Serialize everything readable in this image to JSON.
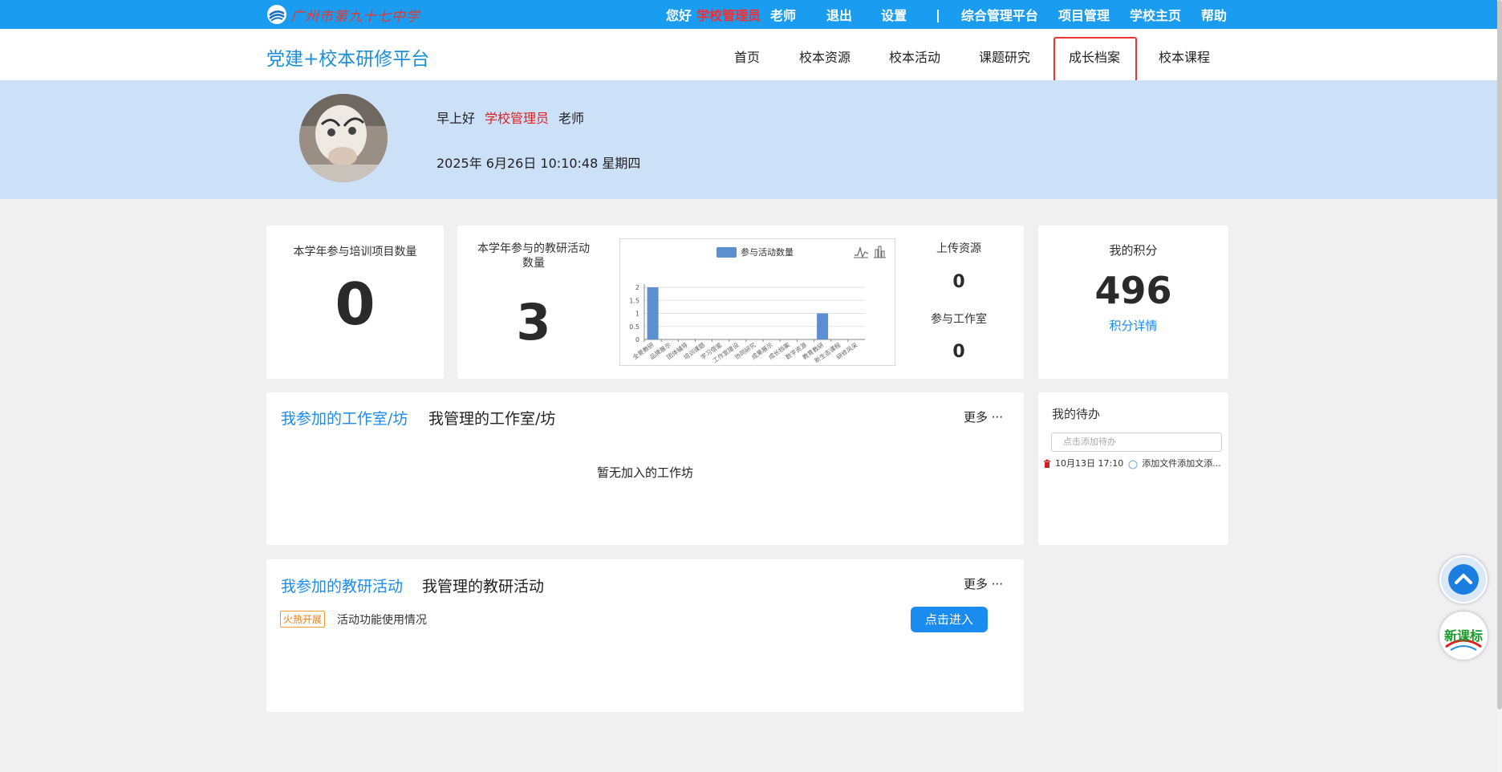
{
  "topbar": {
    "logo_text": "广州市第九十七中学",
    "greeting": "您好",
    "role": "学校管理员",
    "teacher": "老师",
    "logout": "退出",
    "settings": "设置",
    "separator": "|",
    "links": [
      "综合管理平台",
      "项目管理",
      "学校主页",
      "帮助"
    ]
  },
  "nav": {
    "brand": "党建+校本研修平台",
    "items": [
      "首页",
      "校本资源",
      "校本活动",
      "课题研究",
      "成长档案",
      "校本课程"
    ]
  },
  "banner": {
    "greeting": "早上好",
    "role": "学校管理员",
    "teacher": "老师",
    "datetime": "2025年 6月26日 10:10:48 星期四"
  },
  "stats": {
    "training_label": "本学年参与培训项目数量",
    "training_value": "0",
    "activity_label": "本学年参与的教研活动数量",
    "activity_value": "3",
    "upload_label": "上传资源",
    "upload_value": "0",
    "studio_label": "参与工作室",
    "studio_value": "0",
    "points_label": "我的积分",
    "points_value": "496",
    "points_link": "积分详情"
  },
  "chart_data": {
    "type": "bar",
    "categories": [
      "全景教研",
      "品牌展示",
      "团体辅导",
      "培训课题",
      "学习借鉴",
      "工作室建设",
      "协同研究",
      "成果展示",
      "成长档案",
      "数字资源",
      "教育教研",
      "新生态课程",
      "研修风采"
    ],
    "series": [
      {
        "name": "参与活动数量",
        "values": [
          2,
          0,
          0,
          0,
          0,
          0,
          0,
          0,
          0,
          0,
          1,
          0,
          0
        ]
      }
    ],
    "y_ticks": [
      "0",
      "0.5",
      "1",
      "1.5",
      "2"
    ],
    "ylim": [
      0,
      2
    ],
    "legend_position": "top",
    "color": "#5b8fd0"
  },
  "studio": {
    "tab_joined": "我参加的工作室/坊",
    "tab_managed": "我管理的工作室/坊",
    "more": "更多 ···",
    "empty": "暂无加入的工作坊"
  },
  "activity": {
    "tab_joined": "我参加的教研活动",
    "tab_managed": "我管理的教研活动",
    "more": "更多 ···",
    "tag": "火热开展",
    "title": "活动功能使用情况",
    "button": "点击进入"
  },
  "todo": {
    "title": "我的待办",
    "placeholder": "点击添加待办",
    "items": [
      {
        "time": "10月13日 17:10",
        "text": "添加文件添加文添..."
      }
    ]
  },
  "float_logo_text": "新课标",
  "colors": {
    "topbar": "#1a9cf0",
    "brand": "#1a8fd8",
    "banner": "#cce0f8",
    "admin_red": "#e02020",
    "link_blue": "#1a8cf0"
  }
}
